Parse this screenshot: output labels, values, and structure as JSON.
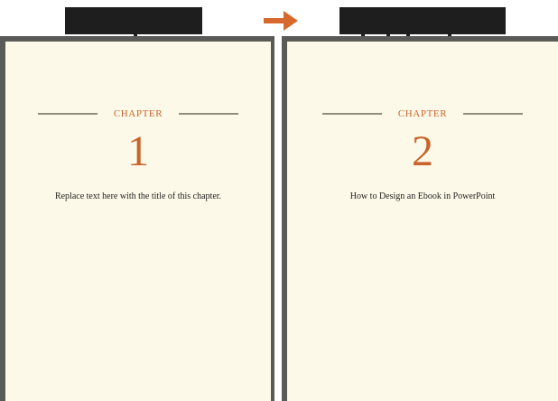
{
  "colors": {
    "accent": "#c8642c",
    "page": "#fdf9e8",
    "frame": "#5a5a56",
    "rule": "#8f8f7b",
    "label_block": "#1e1e1e"
  },
  "arrow": {
    "icon": "right-arrow-icon"
  },
  "left_page": {
    "chapter_label": "CHAPTER",
    "chapter_number": "1",
    "chapter_title": "Replace text here with the title of this chapter."
  },
  "right_page": {
    "chapter_label": "CHAPTER",
    "chapter_number": "2",
    "chapter_title": "How to Design an Ebook in PowerPoint"
  }
}
